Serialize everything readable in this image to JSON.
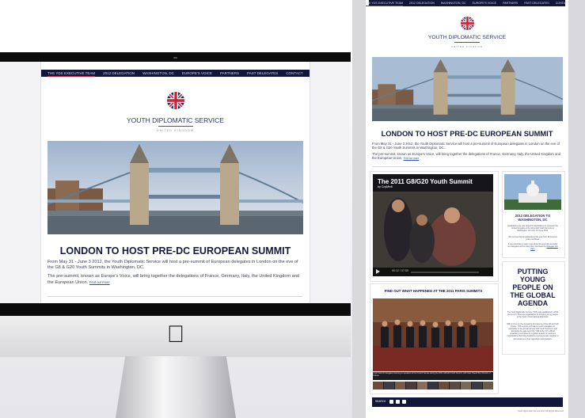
{
  "nav": {
    "items": [
      {
        "label": "THE YDS EXECUTIVE TEAM",
        "active": true
      },
      {
        "label": "2012 DELEGATION",
        "active": false
      },
      {
        "label": "WASHINGTON, DC",
        "active": false
      },
      {
        "label": "EUROPE'S VOICE",
        "active": false
      },
      {
        "label": "PARTNERS",
        "active": false
      },
      {
        "label": "PAST DELEGATES",
        "active": false
      },
      {
        "label": "CONTACT",
        "active": false
      }
    ]
  },
  "brand": {
    "name": "YOUTH DIPLOMATIC SERVICE",
    "subtitle": "UNITED KINGDOM",
    "logo_icon": "union-jack-icon"
  },
  "article": {
    "headline": "LONDON TO HOST PRE-DC EUROPEAN SUMMIT",
    "paragraph1": "From May 31 - June 3 2012, the Youth Diplomatic Service will host a pre-summit of European delegates in London on the eve of the G8 & G20 Youth Summits in Washington, DC.",
    "paragraph2": "The pre-summit, known as Europe's Voice, will bring together the delegations of France, Germany, Italy, the United Kingdom and the European Union.",
    "read_more": "Find out more"
  },
  "video": {
    "title": "The 2011 G8/G20 Youth Summit",
    "byline": "by CoyMedi",
    "time": "00:12 / 07:50"
  },
  "sidebar": {
    "delegation_title": "2012 DELEGATION TO WASHINGTON, DC",
    "delegation_text1": "Applications are now closed for applications to represent the United Kingdom at the G8 & G20 Youth Summits in Washington, DC from 3-6 June 2012.",
    "delegation_text2": "We received hourly applications this year from all previous years combined.",
    "delegation_text3": "If you would like to learn more about the summits and what our delegates will be doing then download the",
    "delegation_link": "Delegate Info Pack",
    "tagline": "PUTTING YOUNG PEOPLE ON THE GLOBAL AGENDA",
    "about_text1": "The Youth Diplomatic Service (YDS) was established in 2011 as the UK's foremost organisation for bringing young people to the heart of international diplomacy.",
    "about_text2": "With a focus on the increasing prominence of the G8 and G20 forums, YDS recruits and trains a youth delegation to participate in the annual G8 and G20 Youth Summits, held alongside the main summits. YDS is the UK's official organising committee for a global network of youth-led organisations that bring hundreds of young people together to find solutions to their agenda at world leaders."
  },
  "paris": {
    "title": "FIND OUT WHAT HAPPENED AT THE 2011 PARIS SUMMITS",
    "caption": "Youth Summit delegates listening to speakers at the French Senate during the 2011 G8/G20 Youth Summit, with Juan Toledo Rio, Director of Culture"
  },
  "footer": {
    "search_label": "SEARCH",
    "copyright": "Youth Diplomatic Service 2012 All Rights Reserved"
  },
  "colors": {
    "navy": "#12163a",
    "accent_red": "#c9243a",
    "brand_blue": "#2b3565",
    "link": "#2b4fa3"
  }
}
